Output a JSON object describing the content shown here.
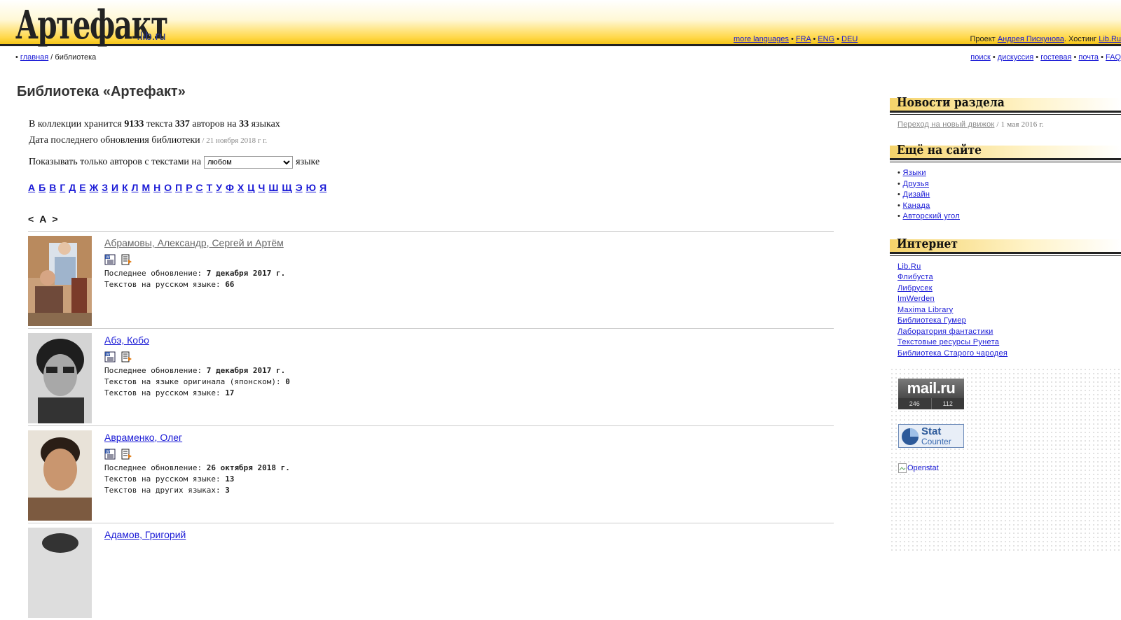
{
  "header": {
    "logo_main": "Артефакт",
    "logo_sub": ".lib.ru",
    "languages": [
      "more languages",
      "FRA",
      "ENG",
      "DEU"
    ],
    "project_prefix": "Проект ",
    "project_link": "Андрея Пискунова",
    "hosting_prefix": ". Хостинг ",
    "hosting_link": "Lib.Ru"
  },
  "breadcrumb": {
    "bullet": "•",
    "home": "главная",
    "sep": " / ",
    "current": "библиотека"
  },
  "topnav": [
    "поиск",
    "дискуссия",
    "гостевая",
    "почта",
    "FAQ"
  ],
  "main": {
    "title": "Библиотека «Артефакт»",
    "stats": {
      "p1": "В коллекции хранится ",
      "texts": "9133",
      "p2": " текста ",
      "authors": "337",
      "p3": " авторов на ",
      "langs": "33",
      "p4": " языках",
      "update_label": "Дата последнего обновления библиотеки",
      "update_date": " / 21 ноября 2018 г г."
    },
    "filter": {
      "prefix": "Показывать только авторов с текстами на",
      "selected": "любом",
      "suffix": "языке"
    },
    "alphabet": [
      "А",
      "Б",
      "В",
      "Г",
      "Д",
      "Е",
      "Ж",
      "З",
      "И",
      "К",
      "Л",
      "М",
      "Н",
      "О",
      "П",
      "Р",
      "С",
      "Т",
      "У",
      "Ф",
      "Х",
      "Ц",
      "Ч",
      "Ш",
      "Щ",
      "Э",
      "Ю",
      "Я"
    ],
    "pager": {
      "prev": "<",
      "current": "А",
      "next": ">"
    },
    "authors": [
      {
        "name": "Абрамовы, Александр, Сергей и Артём",
        "visited": true,
        "meta": [
          {
            "label": "Последнее обновление: ",
            "value": "7 декабря 2017 г."
          },
          {
            "label": "Текстов на русском языке: ",
            "value": "66"
          }
        ]
      },
      {
        "name": "Абэ, Кобо",
        "visited": false,
        "meta": [
          {
            "label": "Последнее обновление: ",
            "value": "7 декабря 2017 г."
          },
          {
            "label": "Текстов на языке оригинала (японском): ",
            "value": "0"
          },
          {
            "label": "Текстов на русском языке: ",
            "value": "17"
          }
        ]
      },
      {
        "name": "Авраменко, Олег",
        "visited": false,
        "meta": [
          {
            "label": "Последнее обновление: ",
            "value": "26 октября 2018 г."
          },
          {
            "label": "Текстов на русском языке: ",
            "value": "13"
          },
          {
            "label": "Текстов на других языках: ",
            "value": "3"
          }
        ]
      },
      {
        "name": "Адамов, Григорий",
        "visited": false,
        "meta": []
      }
    ]
  },
  "sidebar": {
    "news_title": "Новости раздела",
    "news_link": "Переход на новый движок",
    "news_date": " / 1 мая 2016 г.",
    "more_title": "Ещё на сайте",
    "more_items": [
      "Языки",
      "Друзья",
      "Дизайн",
      "Канада",
      "Авторский угол"
    ],
    "internet_title": "Интернет",
    "internet_items": [
      "Lib.Ru",
      "Флибуста",
      "Либрусек",
      "ImWerden",
      "Maxima Library",
      "Библиотека Гумер",
      "Лаборатория фантастики",
      "Текстовые ресурсы Рунета",
      "Библиотека Старого чародея"
    ]
  },
  "counters": {
    "mailru_logo": "mail.ru",
    "mailru_left": "246",
    "mailru_right": "112",
    "stat_line1": "Stat",
    "stat_line2": "Counter",
    "openstat_alt": "Openstat"
  },
  "colors": {
    "link": "#1a1ad6",
    "header_yellow": "#ffd84a",
    "visited": "#666666"
  }
}
